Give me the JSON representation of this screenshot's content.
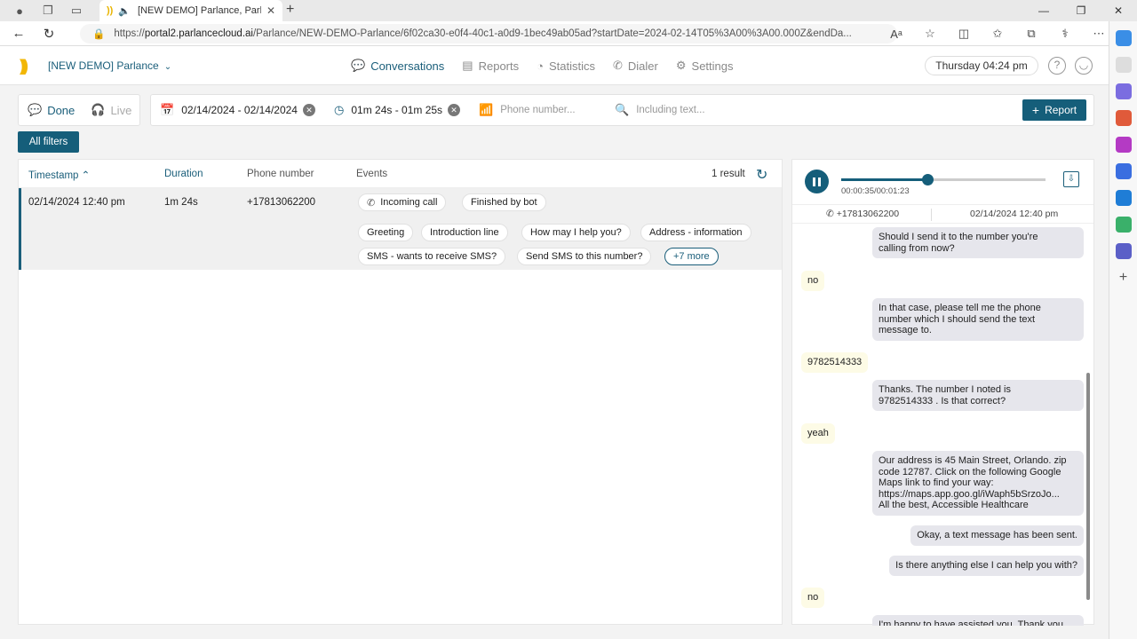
{
  "browser": {
    "tab_title": "[NEW DEMO] Parlance, Parla",
    "url_prefix": "https://",
    "url_host": "portal2.parlancecloud.ai",
    "url_path": "/Parlance/NEW-DEMO-Parlance/6f02ca30-e0f4-40c1-a0d9-1bec49ab05ad?startDate=2024-02-14T05%3A00%3A00.000Z&endDa..."
  },
  "header": {
    "org_name": "[NEW DEMO] Parlance",
    "nav": [
      {
        "label": "Conversations",
        "icon": "chat-icon",
        "active": true
      },
      {
        "label": "Reports",
        "icon": "document-icon",
        "active": false
      },
      {
        "label": "Statistics",
        "icon": "gauge-icon",
        "active": false
      },
      {
        "label": "Dialer",
        "icon": "phone-icon",
        "active": false
      },
      {
        "label": "Settings",
        "icon": "gear-icon",
        "active": false
      }
    ],
    "clock": "Thursday 04:24 pm"
  },
  "modes": {
    "done": "Done",
    "live": "Live"
  },
  "filters": {
    "date_range": "02/14/2024 - 02/14/2024",
    "duration_range": "01m 24s - 01m 25s",
    "phone_placeholder": "Phone number...",
    "text_placeholder": "Including text...",
    "report_label": "Report",
    "all_filters_label": "All filters"
  },
  "table": {
    "columns": {
      "timestamp": "Timestamp",
      "duration": "Duration",
      "phone": "Phone number",
      "events": "Events"
    },
    "result_count": "1 result",
    "row": {
      "timestamp": "02/14/2024 12:40 pm",
      "duration": "1m 24s",
      "phone": "+17813062200",
      "events": [
        "Incoming call",
        "Finished by bot",
        "Greeting",
        "Introduction line",
        "How may I help you?",
        "Address - information",
        "SMS - wants to receive SMS?",
        "Send SMS to this number?"
      ],
      "more_label": "+7 more"
    }
  },
  "player": {
    "time": "00:00:35/00:01:23",
    "progress": 0.42,
    "caller": "+17813062200",
    "datetime": "02/14/2024 12:40 pm"
  },
  "transcript": [
    {
      "role": "bot",
      "text": "Should I send it to the number you're\ncalling from now?"
    },
    {
      "role": "user",
      "text": "no"
    },
    {
      "role": "bot",
      "text": "In that case, please tell me the phone\nnumber which I should send the text\nmessage to."
    },
    {
      "role": "user",
      "text": "9782514333"
    },
    {
      "role": "bot",
      "text": "Thanks. The number I noted is\n9782514333 . Is that correct?"
    },
    {
      "role": "user",
      "text": "yeah"
    },
    {
      "role": "bot",
      "text": "Our address is 45 Main Street, Orlando. zip\ncode 12787. Click on the following Google\nMaps link to find your way:\nhttps://maps.app.goo.gl/iWaph5bSrzoJo...\nAll the best, Accessible Healthcare"
    },
    {
      "role": "bot",
      "text": "Okay, a text message has been sent."
    },
    {
      "role": "bot",
      "text": "Is there anything else I can help you with?"
    },
    {
      "role": "user",
      "text": "no"
    },
    {
      "role": "bot",
      "text": "I'm happy to have assisted you. Thank you"
    }
  ]
}
